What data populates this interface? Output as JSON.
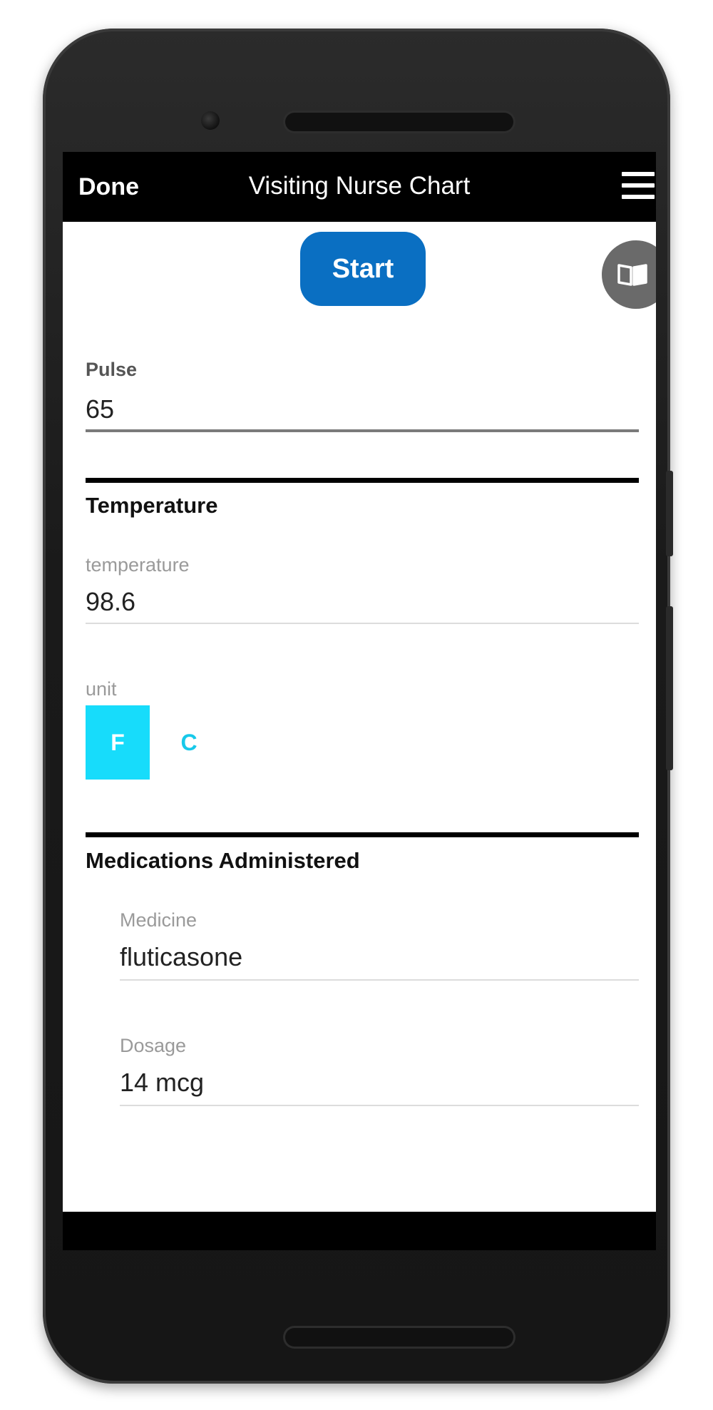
{
  "navbar": {
    "done_label": "Done",
    "title": "Visiting Nurse Chart",
    "menu_icon": "hamburger-menu-icon"
  },
  "toolbar": {
    "start_label": "Start",
    "book_icon": "open-book-icon"
  },
  "pulse": {
    "label": "Pulse",
    "value": "65"
  },
  "temperature_section": {
    "title": "Temperature",
    "temperature_label": "temperature",
    "temperature_value": "98.6",
    "unit_label": "unit",
    "units": [
      "F",
      "C"
    ],
    "selected_unit": "F"
  },
  "medications_section": {
    "title": "Medications Administered",
    "medicine_label": "Medicine",
    "medicine_value": "fluticasone",
    "dosage_label": "Dosage",
    "dosage_value": "14 mcg"
  },
  "colors": {
    "navbar_bg": "#000000",
    "start_button": "#0a6fc2",
    "unit_selected": "#17dcfb",
    "unit_unselected_text": "#17c9ea"
  }
}
